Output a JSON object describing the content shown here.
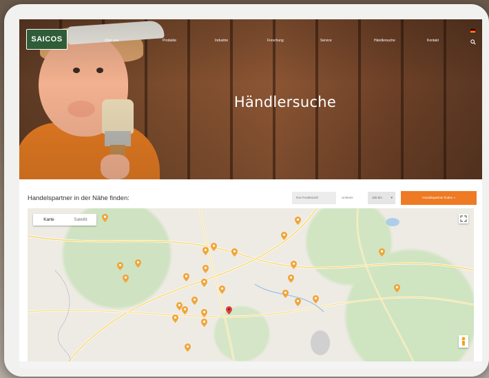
{
  "header": {
    "logo_text": "SAICOS",
    "nav_items": [
      "Über uns",
      "Produkte",
      "Industrie",
      "Forschung",
      "Service",
      "Händlersuche",
      "Kontakt"
    ]
  },
  "hero": {
    "title": "Händlersuche"
  },
  "finder": {
    "title": "Handelspartner in der Nähe finden:",
    "plz_placeholder": "Ihre Postleitzahl",
    "radius_label": "Umkreis",
    "radius_value": "100 km",
    "find_button": "Handelspartner finden »"
  },
  "map": {
    "map_type_options": [
      "Karte",
      "Satellit"
    ],
    "selected_map_type": "Karte",
    "colors": {
      "pin": "#f0a53a",
      "selected_pin": "#d9423a",
      "accent": "#ee7a24"
    }
  }
}
